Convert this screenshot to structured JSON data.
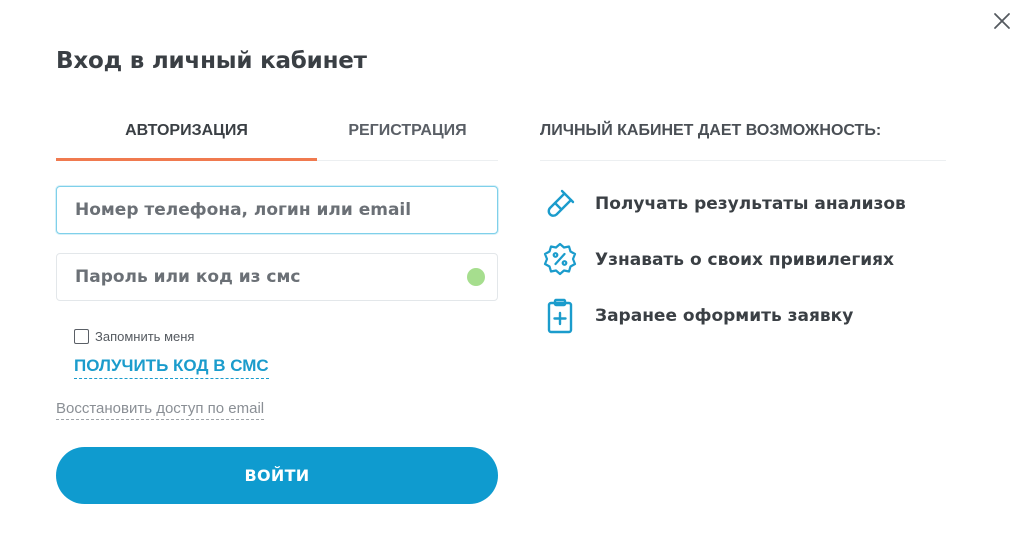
{
  "modal": {
    "title": "Вход в личный кабинет"
  },
  "tabs": [
    {
      "label": "Авторизация",
      "active": true
    },
    {
      "label": "Регистрация",
      "active": false
    }
  ],
  "form": {
    "phone_placeholder": "Номер телефона, логин или email",
    "password_placeholder": "Пароль или код из смс",
    "remember_label": "Запомнить меня",
    "remember_checked": false,
    "sms_link": "ПОЛУЧИТЬ КОД В СМС",
    "restore_link": "Восстановить доступ по email",
    "submit_label": "Войти"
  },
  "features": {
    "header": "ЛИЧНЫЙ КАБИНЕТ ДАЕТ ВОЗМОЖНОСТЬ:",
    "items": [
      {
        "icon": "test-tube-icon",
        "text": "Получать результаты анализов"
      },
      {
        "icon": "discount-badge-icon",
        "text": "Узнавать о своих привилегиях"
      },
      {
        "icon": "medical-clipboard-icon",
        "text": "Заранее оформить заявку"
      }
    ]
  },
  "colors": {
    "accent": "#0f9bcf",
    "active_tab_underline": "#f07a4f",
    "status_dot": "#a6de8e",
    "text": "#3a3f44"
  },
  "icons": {
    "close": "close-icon"
  }
}
